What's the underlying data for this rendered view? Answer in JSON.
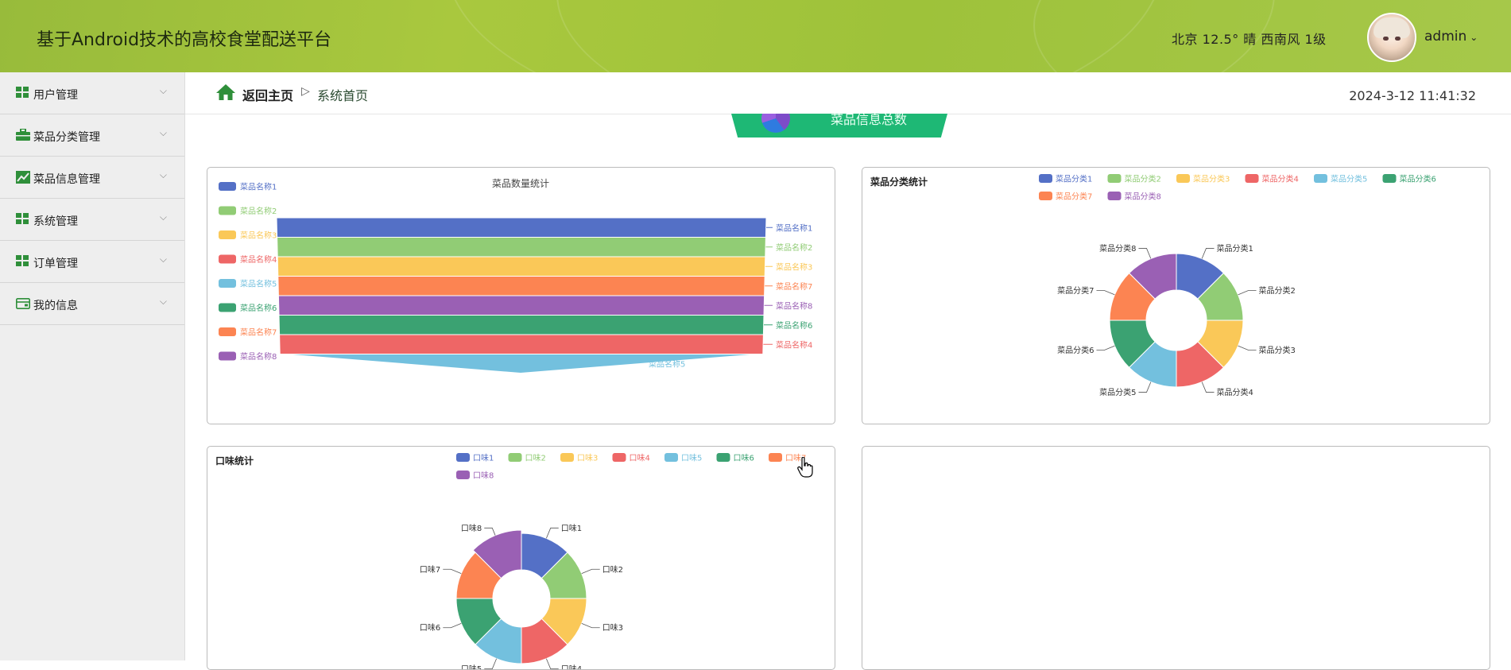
{
  "header": {
    "app_title": "基于Android技术的高校食堂配送平台",
    "weather": "北京  12.5°  晴  西南风  1级",
    "username": "admin",
    "username_caret": "⌄"
  },
  "sidebar": {
    "items": [
      {
        "label": "用户管理",
        "icon": "grid-icon"
      },
      {
        "label": "菜品分类管理",
        "icon": "briefcase-icon"
      },
      {
        "label": "菜品信息管理",
        "icon": "line-chart-icon"
      },
      {
        "label": "系统管理",
        "icon": "grid-icon"
      },
      {
        "label": "订单管理",
        "icon": "grid-icon"
      },
      {
        "label": "我的信息",
        "icon": "wallet-icon"
      }
    ],
    "chevron": "⌵"
  },
  "breadcrumb": {
    "home_label": "返回主页",
    "separator": "▷",
    "current": "系统首页",
    "datetime": "2024-3-12 11:41:32"
  },
  "banner": {
    "label": "菜品信息总数"
  },
  "colors": {
    "palette": [
      "#5470c6",
      "#91cc75",
      "#fac858",
      "#ee6666",
      "#73c0de",
      "#3ba272",
      "#fc8452",
      "#9a60b4"
    ],
    "header_green": "#a6c63e",
    "banner_green": "#1eb875"
  },
  "chart_data": [
    {
      "type": "funnel",
      "title": "菜品数量统计",
      "legend": [
        "菜品名称1",
        "菜品名称2",
        "菜品名称3",
        "菜品名称4",
        "菜品名称5",
        "菜品名称6",
        "菜品名称7",
        "菜品名称8"
      ],
      "order_top_to_bottom": [
        "菜品名称1",
        "菜品名称2",
        "菜品名称3",
        "菜品名称7",
        "菜品名称8",
        "菜品名称6",
        "菜品名称4",
        "菜品名称5"
      ]
    },
    {
      "type": "pie",
      "title": "菜品分类统计",
      "donut": true,
      "categories": [
        "菜品分类1",
        "菜品分类2",
        "菜品分类3",
        "菜品分类4",
        "菜品分类5",
        "菜品分类6",
        "菜品分类7",
        "菜品分类8"
      ],
      "values": [
        1,
        1,
        1,
        1,
        1,
        1,
        1,
        1
      ]
    },
    {
      "type": "pie",
      "title": "口味统计",
      "donut": true,
      "categories": [
        "口味1",
        "口味2",
        "口味3",
        "口味4",
        "口味5",
        "口味6",
        "口味7",
        "口味8"
      ],
      "values": [
        1,
        1,
        1,
        1,
        1,
        1,
        1,
        1
      ]
    }
  ]
}
